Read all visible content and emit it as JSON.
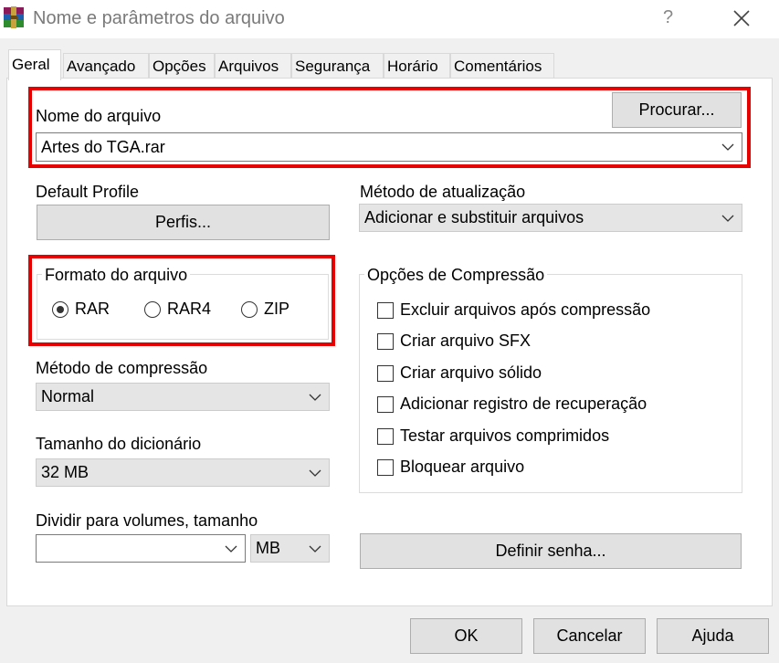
{
  "window": {
    "title": "Nome e parâmetros do arquivo",
    "help_glyph": "?"
  },
  "tabs": [
    {
      "label": "Geral"
    },
    {
      "label": "Avançado"
    },
    {
      "label": "Opções"
    },
    {
      "label": "Arquivos"
    },
    {
      "label": "Segurança"
    },
    {
      "label": "Horário"
    },
    {
      "label": "Comentários"
    }
  ],
  "archive_name": {
    "label": "Nome do arquivo",
    "value": "Artes do TGA.rar",
    "browse_label": "Procurar..."
  },
  "default_profile": {
    "label": "Default Profile",
    "button_label": "Perfis..."
  },
  "update_method": {
    "label": "Método de atualização",
    "value": "Adicionar e substituir arquivos"
  },
  "archive_format": {
    "title": "Formato do arquivo",
    "options": [
      {
        "label": "RAR",
        "selected": true
      },
      {
        "label": "RAR4",
        "selected": false
      },
      {
        "label": "ZIP",
        "selected": false
      }
    ]
  },
  "compression_options": {
    "title": "Opções de Compressão",
    "items": [
      {
        "label": "Excluir arquivos após compressão",
        "checked": false
      },
      {
        "label": "Criar arquivo SFX",
        "checked": false
      },
      {
        "label": "Criar arquivo sólido",
        "checked": false
      },
      {
        "label": "Adicionar registro de recuperação",
        "checked": false
      },
      {
        "label": "Testar arquivos comprimidos",
        "checked": false
      },
      {
        "label": "Bloquear arquivo",
        "checked": false
      }
    ]
  },
  "compression_method": {
    "label": "Método de compressão",
    "value": "Normal"
  },
  "dictionary_size": {
    "label": "Tamanho do dicionário",
    "value": "32 MB"
  },
  "split_volumes": {
    "label": "Dividir para volumes, tamanho",
    "value": "",
    "unit": "MB"
  },
  "set_password": {
    "label": "Definir senha..."
  },
  "footer": {
    "ok": "OK",
    "cancel": "Cancelar",
    "help": "Ajuda"
  },
  "colors": {
    "highlight": "#e60000",
    "button_bg": "#e1e1e1",
    "window_bg": "#f0f0f0"
  }
}
